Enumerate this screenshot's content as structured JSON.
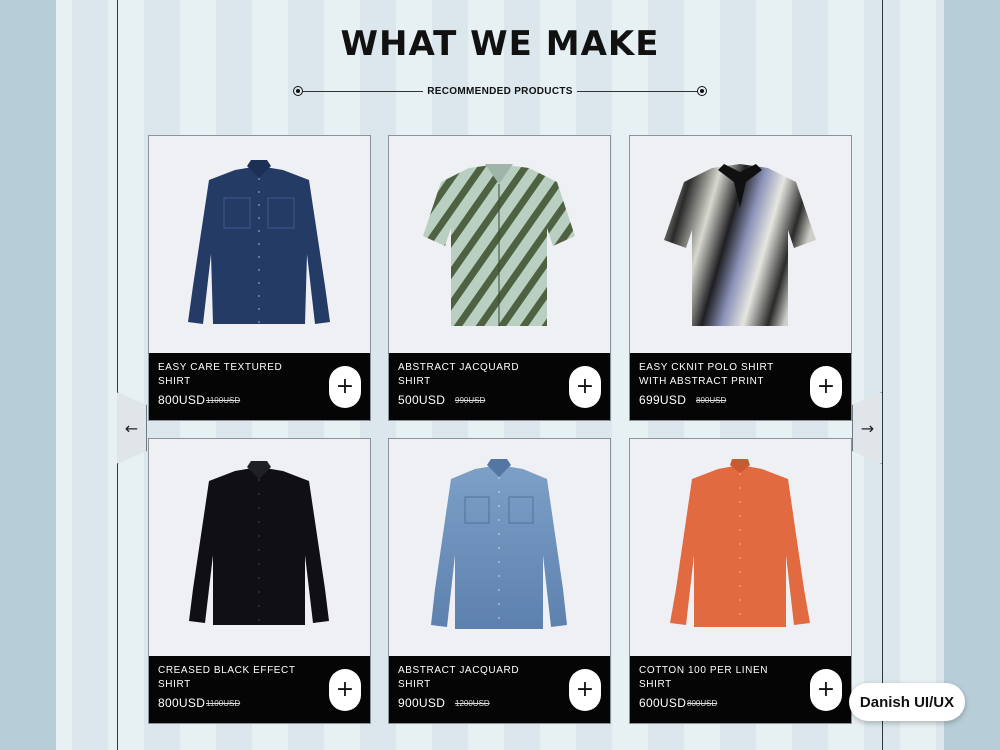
{
  "header": {
    "title": "WHAT WE MAKE",
    "subtitle": "RECOMMENDED PRODUCTS"
  },
  "carousel": {
    "prev_arrow": "←",
    "next_arrow": "→"
  },
  "products": [
    {
      "name": "EASY CARE TEXTURED SHIRT",
      "price": "800USD",
      "old_price": "1100USD",
      "add_label": "+",
      "image": "navy-denim-shirt",
      "color": "#243b66"
    },
    {
      "name": "ABSTRACT JACQUARD SHIRT",
      "price": "500USD",
      "old_price": "990USD",
      "add_label": "+",
      "image": "green-zebra-print-shirt",
      "color": "#5a6b45"
    },
    {
      "name": "EASY CKNIT POLO SHIRT WITH ABSTRACT PRINT",
      "price": "699USD",
      "old_price": "800USD",
      "add_label": "+",
      "image": "abstract-print-polo",
      "color": "#2b2b2b"
    },
    {
      "name": "CREASED BLACK EFFECT SHIRT",
      "price": "800USD",
      "old_price": "1100USD",
      "add_label": "+",
      "image": "black-shirt",
      "color": "#101014"
    },
    {
      "name": "ABSTRACT JACQUARD SHIRT",
      "price": "900USD",
      "old_price": "1200USD",
      "add_label": "+",
      "image": "light-denim-shirt",
      "color": "#6f92bd"
    },
    {
      "name": "COTTON 100 PER LINEN SHIRT",
      "price": "600USD",
      "old_price": "800USD",
      "add_label": "+",
      "image": "orange-linen-shirt",
      "color": "#e16a40"
    }
  ],
  "badge": {
    "label": "Danish UI/UX"
  },
  "colors": {
    "background": "#e3ecf0",
    "card_info_bg": "#050505",
    "accent_text": "#111111"
  }
}
